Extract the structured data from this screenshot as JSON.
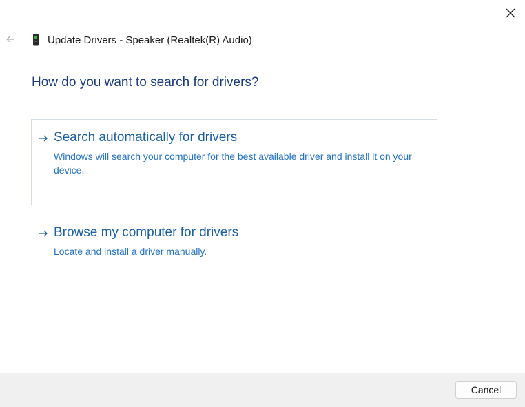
{
  "window": {
    "title": "Update Drivers - Speaker (Realtek(R) Audio)",
    "title_icon": "speaker-device-icon",
    "back_icon": "back-arrow-icon",
    "close_icon": "close-icon"
  },
  "main": {
    "heading": "How do you want to search for drivers?",
    "options": [
      {
        "title": "Search automatically for drivers",
        "description": "Windows will search your computer for the best available driver and install it on your device.",
        "icon": "arrow-right-icon",
        "selected": true
      },
      {
        "title": "Browse my computer for drivers",
        "description": "Locate and install a driver manually.",
        "icon": "arrow-right-icon",
        "selected": false
      }
    ]
  },
  "footer": {
    "cancel_label": "Cancel"
  },
  "colors": {
    "heading": "#1a3a80",
    "link": "#1a61a8",
    "description": "#2573c5",
    "footer_bg": "#f0f0f0"
  }
}
